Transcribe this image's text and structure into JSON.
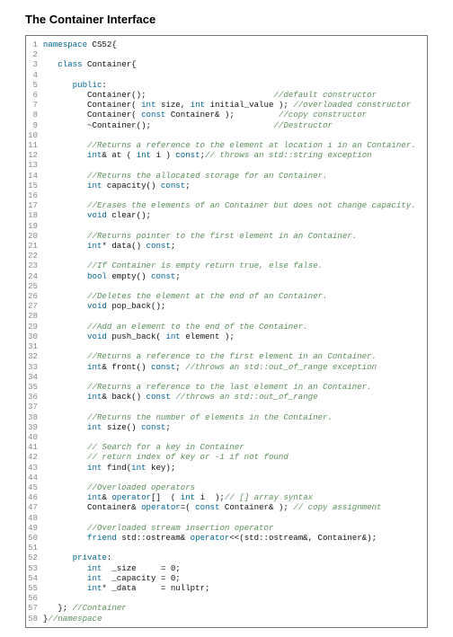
{
  "title": "The Container Interface",
  "code": {
    "lines": [
      {
        "num": 1,
        "segs": [
          {
            "t": "namespace",
            "c": "kw"
          },
          {
            "t": " CS52{",
            "c": ""
          }
        ]
      },
      {
        "num": 2,
        "segs": []
      },
      {
        "num": 3,
        "segs": [
          {
            "t": "   ",
            "c": ""
          },
          {
            "t": "class",
            "c": "kw"
          },
          {
            "t": " Container{",
            "c": ""
          }
        ]
      },
      {
        "num": 4,
        "segs": []
      },
      {
        "num": 5,
        "segs": [
          {
            "t": "      ",
            "c": ""
          },
          {
            "t": "public",
            "c": "kw"
          },
          {
            "t": ":",
            "c": ""
          }
        ]
      },
      {
        "num": 6,
        "segs": [
          {
            "t": "         Container();                          ",
            "c": ""
          },
          {
            "t": "//default constructor",
            "c": "cm"
          }
        ]
      },
      {
        "num": 7,
        "segs": [
          {
            "t": "         Container( ",
            "c": ""
          },
          {
            "t": "int",
            "c": "kw"
          },
          {
            "t": " size, ",
            "c": ""
          },
          {
            "t": "int",
            "c": "kw"
          },
          {
            "t": " initial_value ); ",
            "c": ""
          },
          {
            "t": "//overloaded constructor",
            "c": "cm"
          }
        ]
      },
      {
        "num": 8,
        "segs": [
          {
            "t": "         Container( ",
            "c": ""
          },
          {
            "t": "const",
            "c": "kw"
          },
          {
            "t": " Container& );         ",
            "c": ""
          },
          {
            "t": "//copy constructor",
            "c": "cm"
          }
        ]
      },
      {
        "num": 9,
        "segs": [
          {
            "t": "         ~Container();                         ",
            "c": ""
          },
          {
            "t": "//Destructor",
            "c": "cm"
          }
        ]
      },
      {
        "num": 10,
        "segs": []
      },
      {
        "num": 11,
        "segs": [
          {
            "t": "         ",
            "c": ""
          },
          {
            "t": "//Returns a reference to the element at location i in an Container.",
            "c": "cm"
          }
        ]
      },
      {
        "num": 12,
        "segs": [
          {
            "t": "         ",
            "c": ""
          },
          {
            "t": "int",
            "c": "kw"
          },
          {
            "t": "& at ( ",
            "c": ""
          },
          {
            "t": "int",
            "c": "kw"
          },
          {
            "t": " i ) ",
            "c": ""
          },
          {
            "t": "const",
            "c": "kw"
          },
          {
            "t": ";",
            "c": ""
          },
          {
            "t": "// throws an std::string exception",
            "c": "cm"
          }
        ]
      },
      {
        "num": 13,
        "segs": []
      },
      {
        "num": 14,
        "segs": [
          {
            "t": "         ",
            "c": ""
          },
          {
            "t": "//Returns the allocated storage for an Container.",
            "c": "cm"
          }
        ]
      },
      {
        "num": 15,
        "segs": [
          {
            "t": "         ",
            "c": ""
          },
          {
            "t": "int",
            "c": "kw"
          },
          {
            "t": " capacity() ",
            "c": ""
          },
          {
            "t": "const",
            "c": "kw"
          },
          {
            "t": ";",
            "c": ""
          }
        ]
      },
      {
        "num": 16,
        "segs": []
      },
      {
        "num": 17,
        "segs": [
          {
            "t": "         ",
            "c": ""
          },
          {
            "t": "//Erases the elements of an Container but does not change capacity.",
            "c": "cm"
          }
        ]
      },
      {
        "num": 18,
        "segs": [
          {
            "t": "         ",
            "c": ""
          },
          {
            "t": "void",
            "c": "kw"
          },
          {
            "t": " clear();",
            "c": ""
          }
        ]
      },
      {
        "num": 19,
        "segs": []
      },
      {
        "num": 20,
        "segs": [
          {
            "t": "         ",
            "c": ""
          },
          {
            "t": "//Returns pointer to the first element in an Container.",
            "c": "cm"
          }
        ]
      },
      {
        "num": 21,
        "segs": [
          {
            "t": "         ",
            "c": ""
          },
          {
            "t": "int",
            "c": "kw"
          },
          {
            "t": "* data() ",
            "c": ""
          },
          {
            "t": "const",
            "c": "kw"
          },
          {
            "t": ";",
            "c": ""
          }
        ]
      },
      {
        "num": 22,
        "segs": []
      },
      {
        "num": 23,
        "segs": [
          {
            "t": "         ",
            "c": ""
          },
          {
            "t": "//If Container is empty return true, else false.",
            "c": "cm"
          }
        ]
      },
      {
        "num": 24,
        "segs": [
          {
            "t": "         ",
            "c": ""
          },
          {
            "t": "bool",
            "c": "kw"
          },
          {
            "t": " empty() ",
            "c": ""
          },
          {
            "t": "const",
            "c": "kw"
          },
          {
            "t": ";",
            "c": ""
          }
        ]
      },
      {
        "num": 25,
        "segs": []
      },
      {
        "num": 26,
        "segs": [
          {
            "t": "         ",
            "c": ""
          },
          {
            "t": "//Deletes the element at the end of an Container.",
            "c": "cm"
          }
        ]
      },
      {
        "num": 27,
        "segs": [
          {
            "t": "         ",
            "c": ""
          },
          {
            "t": "void",
            "c": "kw"
          },
          {
            "t": " pop_back();",
            "c": ""
          }
        ]
      },
      {
        "num": 28,
        "segs": []
      },
      {
        "num": 29,
        "segs": [
          {
            "t": "         ",
            "c": ""
          },
          {
            "t": "//Add an element to the end of the Container.",
            "c": "cm"
          }
        ]
      },
      {
        "num": 30,
        "segs": [
          {
            "t": "         ",
            "c": ""
          },
          {
            "t": "void",
            "c": "kw"
          },
          {
            "t": " push_back( ",
            "c": ""
          },
          {
            "t": "int",
            "c": "kw"
          },
          {
            "t": " element );",
            "c": ""
          }
        ]
      },
      {
        "num": 31,
        "segs": []
      },
      {
        "num": 32,
        "segs": [
          {
            "t": "         ",
            "c": ""
          },
          {
            "t": "//Returns a reference to the first element in an Container.",
            "c": "cm"
          }
        ]
      },
      {
        "num": 33,
        "segs": [
          {
            "t": "         ",
            "c": ""
          },
          {
            "t": "int",
            "c": "kw"
          },
          {
            "t": "& front() ",
            "c": ""
          },
          {
            "t": "const",
            "c": "kw"
          },
          {
            "t": "; ",
            "c": ""
          },
          {
            "t": "//throws an std::out_of_range exception",
            "c": "cm"
          }
        ]
      },
      {
        "num": 34,
        "segs": []
      },
      {
        "num": 35,
        "segs": [
          {
            "t": "         ",
            "c": ""
          },
          {
            "t": "//Returns a reference to the last element in an Container.",
            "c": "cm"
          }
        ]
      },
      {
        "num": 36,
        "segs": [
          {
            "t": "         ",
            "c": ""
          },
          {
            "t": "int",
            "c": "kw"
          },
          {
            "t": "& back() ",
            "c": ""
          },
          {
            "t": "const",
            "c": "kw"
          },
          {
            "t": " ",
            "c": ""
          },
          {
            "t": "//throws an std::out_of_range",
            "c": "cm"
          }
        ]
      },
      {
        "num": 37,
        "segs": []
      },
      {
        "num": 38,
        "segs": [
          {
            "t": "         ",
            "c": ""
          },
          {
            "t": "//Returns the number of elements in the Container.",
            "c": "cm"
          }
        ]
      },
      {
        "num": 39,
        "segs": [
          {
            "t": "         ",
            "c": ""
          },
          {
            "t": "int",
            "c": "kw"
          },
          {
            "t": " size() ",
            "c": ""
          },
          {
            "t": "const",
            "c": "kw"
          },
          {
            "t": ";",
            "c": ""
          }
        ]
      },
      {
        "num": 40,
        "segs": []
      },
      {
        "num": 41,
        "segs": [
          {
            "t": "         ",
            "c": ""
          },
          {
            "t": "// Search for a key in Container",
            "c": "cm"
          }
        ]
      },
      {
        "num": 42,
        "segs": [
          {
            "t": "         ",
            "c": ""
          },
          {
            "t": "// return index of key or -1 if not found",
            "c": "cm"
          }
        ]
      },
      {
        "num": 43,
        "segs": [
          {
            "t": "         ",
            "c": ""
          },
          {
            "t": "int",
            "c": "kw"
          },
          {
            "t": " find(",
            "c": ""
          },
          {
            "t": "int",
            "c": "kw"
          },
          {
            "t": " key);",
            "c": ""
          }
        ]
      },
      {
        "num": 44,
        "segs": []
      },
      {
        "num": 45,
        "segs": [
          {
            "t": "         ",
            "c": ""
          },
          {
            "t": "//Overloaded operators",
            "c": "cm"
          }
        ]
      },
      {
        "num": 46,
        "segs": [
          {
            "t": "         ",
            "c": ""
          },
          {
            "t": "int",
            "c": "kw"
          },
          {
            "t": "& ",
            "c": ""
          },
          {
            "t": "operator",
            "c": "kw"
          },
          {
            "t": "[]  ( ",
            "c": ""
          },
          {
            "t": "int",
            "c": "kw"
          },
          {
            "t": " i  );",
            "c": ""
          },
          {
            "t": "// [] array syntax",
            "c": "cm"
          }
        ]
      },
      {
        "num": 47,
        "segs": [
          {
            "t": "         Container& ",
            "c": ""
          },
          {
            "t": "operator",
            "c": "kw"
          },
          {
            "t": "=( ",
            "c": ""
          },
          {
            "t": "const",
            "c": "kw"
          },
          {
            "t": " Container& ); ",
            "c": ""
          },
          {
            "t": "// copy assignment",
            "c": "cm"
          }
        ]
      },
      {
        "num": 48,
        "segs": []
      },
      {
        "num": 49,
        "segs": [
          {
            "t": "         ",
            "c": ""
          },
          {
            "t": "//Overloaded stream insertion operator",
            "c": "cm"
          }
        ]
      },
      {
        "num": 50,
        "segs": [
          {
            "t": "         ",
            "c": ""
          },
          {
            "t": "friend",
            "c": "kw"
          },
          {
            "t": " std::ostream& ",
            "c": ""
          },
          {
            "t": "operator",
            "c": "kw"
          },
          {
            "t": "<<(std::ostream&, Container&);",
            "c": ""
          }
        ]
      },
      {
        "num": 51,
        "segs": []
      },
      {
        "num": 52,
        "segs": [
          {
            "t": "      ",
            "c": ""
          },
          {
            "t": "private",
            "c": "kw"
          },
          {
            "t": ":",
            "c": ""
          }
        ]
      },
      {
        "num": 53,
        "segs": [
          {
            "t": "         ",
            "c": ""
          },
          {
            "t": "int",
            "c": "kw"
          },
          {
            "t": "  _size     = 0;",
            "c": ""
          }
        ]
      },
      {
        "num": 54,
        "segs": [
          {
            "t": "         ",
            "c": ""
          },
          {
            "t": "int",
            "c": "kw"
          },
          {
            "t": "  _capacity = 0;",
            "c": ""
          }
        ]
      },
      {
        "num": 55,
        "segs": [
          {
            "t": "         ",
            "c": ""
          },
          {
            "t": "int",
            "c": "kw"
          },
          {
            "t": "* _data     = nullptr;",
            "c": ""
          }
        ]
      },
      {
        "num": 56,
        "segs": []
      },
      {
        "num": 57,
        "segs": [
          {
            "t": "   }; ",
            "c": ""
          },
          {
            "t": "//Container",
            "c": "cm"
          }
        ]
      },
      {
        "num": 58,
        "segs": [
          {
            "t": "}",
            "c": ""
          },
          {
            "t": "//namespace",
            "c": "cm"
          }
        ]
      }
    ]
  }
}
